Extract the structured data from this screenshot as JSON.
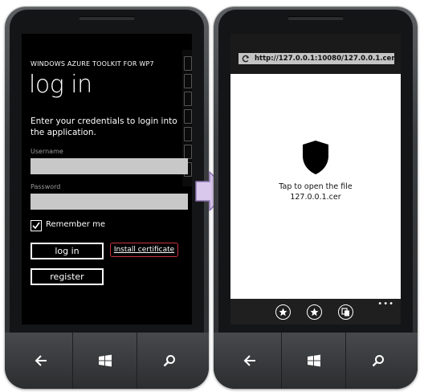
{
  "phone1": {
    "app_title": "WINDOWS AZURE TOOLKIT FOR WP7",
    "page_title": "log in",
    "description": "Enter your credentials to login into the application.",
    "username_label": "Username",
    "username_value": "",
    "password_label": "Password",
    "password_value": "",
    "remember_label": "Remember me",
    "remember_checked": true,
    "login_label": "log in",
    "install_cert_label": "Install certificate",
    "register_label": "register"
  },
  "phone2": {
    "url": "http://127.0.0.1:10080/127.0.0.1.cer",
    "message_line1": "Tap to open the file",
    "message_line2": "127.0.0.1.cer",
    "more_label": "•••"
  },
  "colors": {
    "screen_bg": "#000000",
    "input_bg": "#c8c8c8",
    "highlight_border": "#c8343c",
    "arrow_fill": "#d9c8ec",
    "arrow_stroke": "#8d77b3"
  },
  "icons": {
    "hardware": [
      "back-icon",
      "windows-start-icon",
      "search-icon"
    ],
    "appbar": [
      "add-favorite-icon",
      "favorites-icon",
      "tabs-icon"
    ]
  }
}
